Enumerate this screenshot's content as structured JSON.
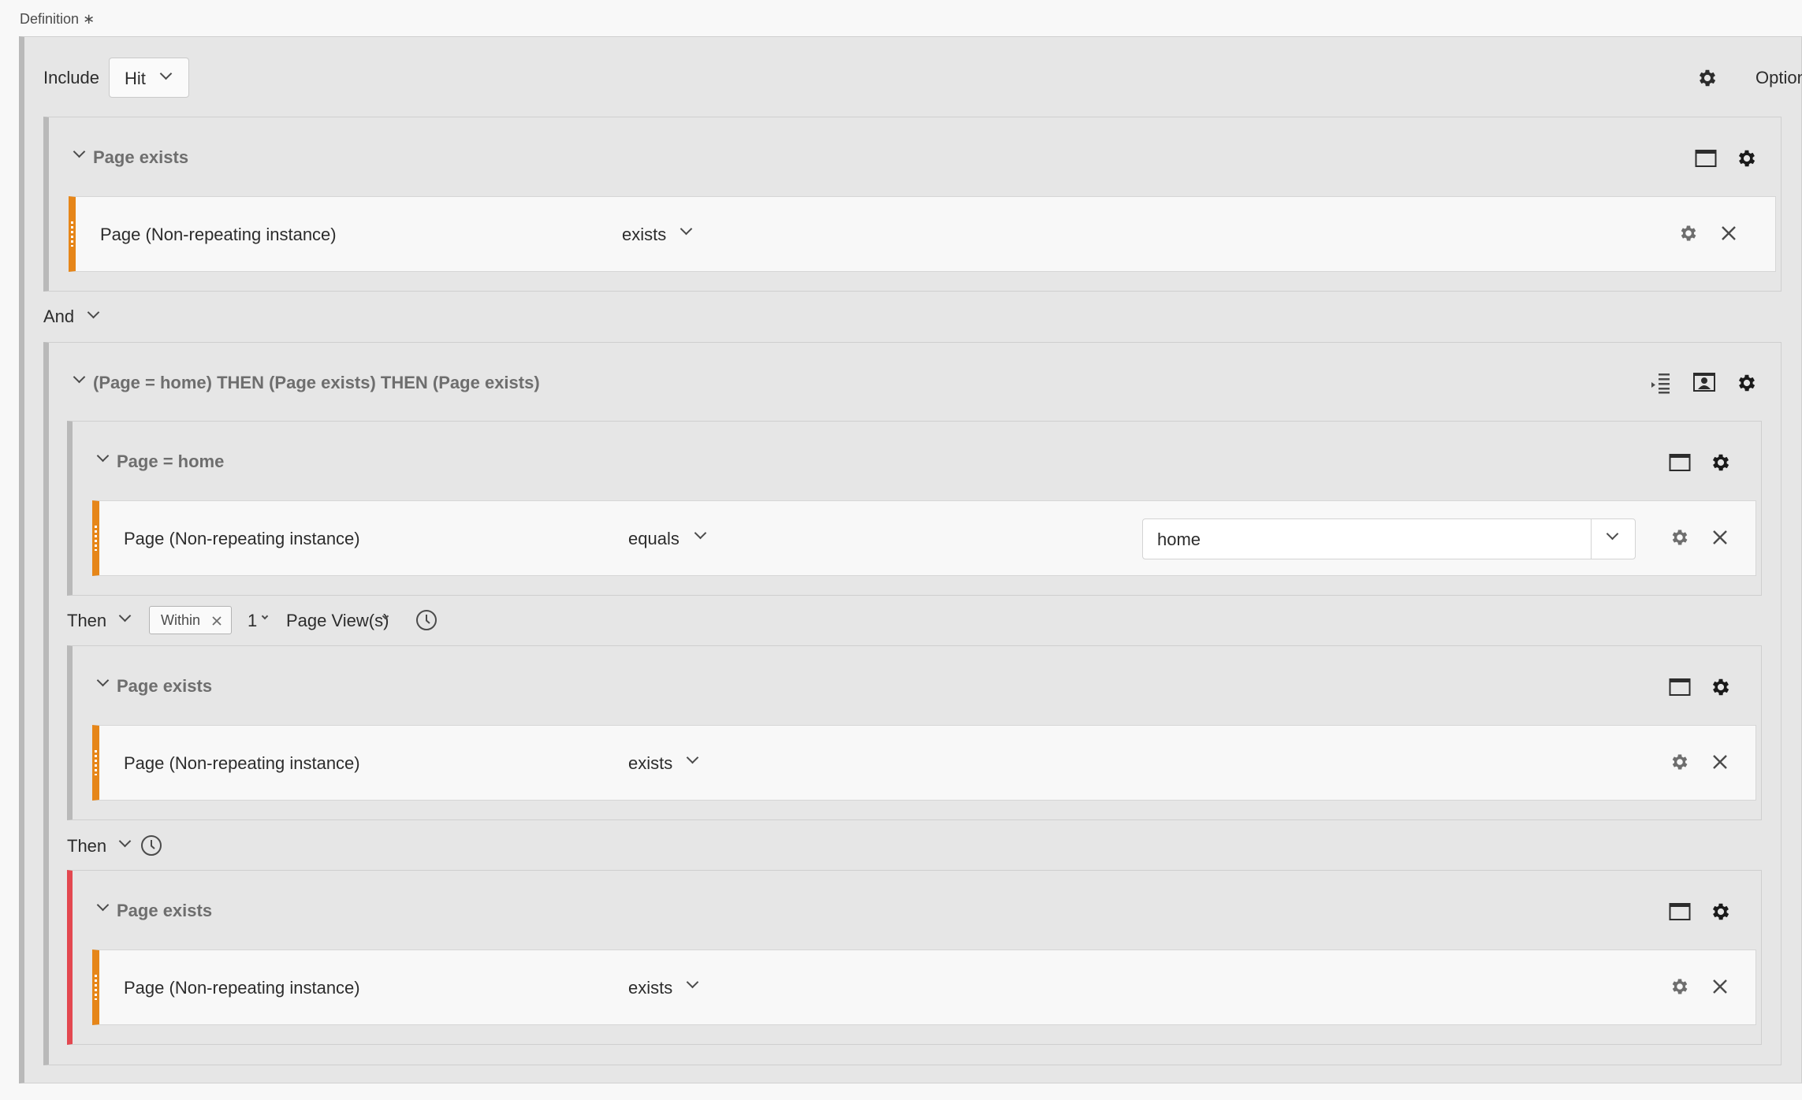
{
  "definition": {
    "label": "Definition",
    "required_mark": "∗"
  },
  "header": {
    "include_label": "Include",
    "scope_value": "Hit",
    "options_label": "Options"
  },
  "container1": {
    "title": "Page exists",
    "rule": {
      "dimension": "Page (Non-repeating instance)",
      "operator": "exists"
    }
  },
  "logic_operator": "And",
  "sequence": {
    "title": "(Page = home) THEN (Page exists) THEN (Page exists)",
    "step1": {
      "title": "Page = home",
      "rule": {
        "dimension": "Page (Non-repeating instance)",
        "operator": "equals",
        "value": "home"
      }
    },
    "then1": {
      "label": "Then",
      "within_tag": "Within",
      "count": "1",
      "unit": "Page View(s)"
    },
    "step2": {
      "title": "Page exists",
      "rule": {
        "dimension": "Page (Non-repeating instance)",
        "operator": "exists"
      }
    },
    "then2": {
      "label": "Then"
    },
    "step3": {
      "title": "Page exists",
      "rule": {
        "dimension": "Page (Non-repeating instance)",
        "operator": "exists"
      }
    }
  },
  "colors": {
    "rule_accent": "#e68619",
    "exclude_accent": "#e34850",
    "container_bg": "#e6e6e6"
  }
}
